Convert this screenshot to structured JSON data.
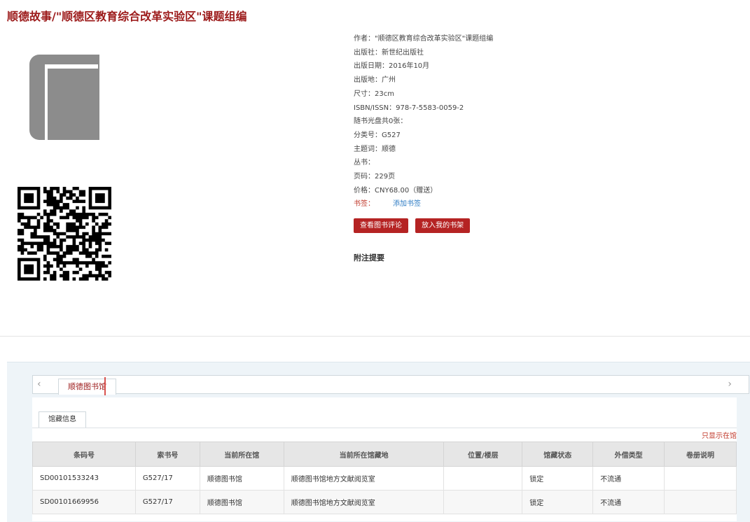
{
  "title": "顺德故事/\"顺德区教育综合改革实验区\"课题组编",
  "icons": {
    "book": "book-icon",
    "qr": "qr-code-icon"
  },
  "meta": [
    "作者：\"顺德区教育综合改革实验区\"课题组编",
    "出版社：新世纪出版社",
    "出版日期：2016年10月",
    "出版地：广州",
    "尺寸：23cm",
    "ISBN/ISSN：978-7-5583-0059-2",
    "随书光盘共0张：",
    "分类号：G527",
    "主题词：顺德",
    "丛书：",
    "页码：229页",
    "价格：CNY68.00（赠送）"
  ],
  "bookmark": {
    "label": "书签：",
    "link": "添加书签"
  },
  "buttons": {
    "review": "查看图书评论",
    "shelf": "放入我的书架"
  },
  "abstract_label": "附注提要",
  "library_tab": "顺德图书馆",
  "subtab": "馆藏信息",
  "only_show": "只显示在馆",
  "table": {
    "headers": [
      "条码号",
      "索书号",
      "当前所在馆",
      "当前所在馆藏地",
      "位置/楼层",
      "馆藏状态",
      "外借类型",
      "卷册说明"
    ],
    "rows": [
      [
        "SD00101533243",
        "G527/17",
        "顺德图书馆",
        "顺德图书馆地方文献阅览室",
        "",
        "锁定",
        "不流通",
        ""
      ],
      [
        "SD00101669956",
        "G527/17",
        "顺德图书馆",
        "顺德图书馆地方文献阅览室",
        "",
        "锁定",
        "不流通",
        ""
      ]
    ]
  },
  "colors": {
    "accent": "#b52323",
    "title": "#9c1a1a",
    "link": "#2e7cc4"
  }
}
